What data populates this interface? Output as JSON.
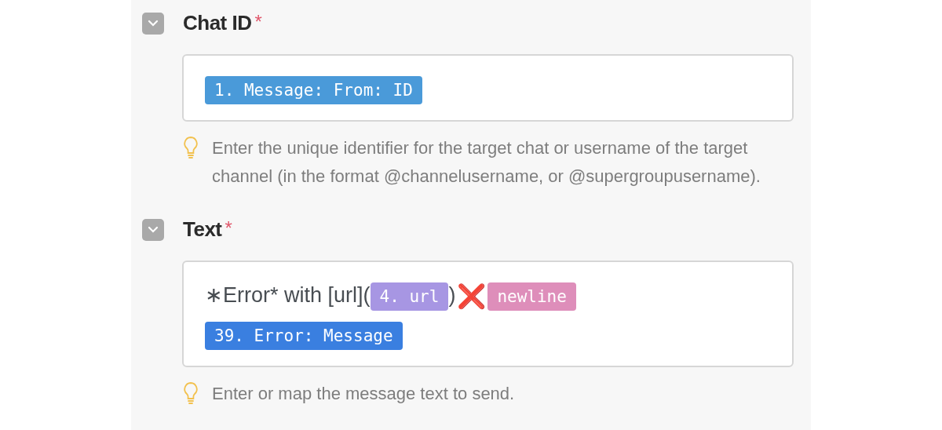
{
  "fields": [
    {
      "label": "Chat ID",
      "required_mark": "*",
      "expanded": true,
      "tokens": [
        {
          "kind": "pill",
          "text": "1. Message: From: ID",
          "color": "#4a9ad9"
        }
      ],
      "hint": "Enter the unique identifier for the target chat or username of the target channel (in the format @channelusername, or @supergroupusername)."
    },
    {
      "label": "Text",
      "required_mark": "*",
      "expanded": true,
      "tokens": [
        {
          "kind": "text",
          "text": "∗Error* with [url]("
        },
        {
          "kind": "pill",
          "text": "4. url",
          "color": "#a796e3"
        },
        {
          "kind": "text",
          "text": ")"
        },
        {
          "kind": "cross",
          "text": "❌"
        },
        {
          "kind": "pill",
          "text": "newline",
          "color": "#de8eba"
        },
        {
          "kind": "break"
        },
        {
          "kind": "pill",
          "text": "39. Error: Message",
          "color": "#3a7fe0"
        }
      ],
      "hint": "Enter or map the message text to send."
    }
  ]
}
